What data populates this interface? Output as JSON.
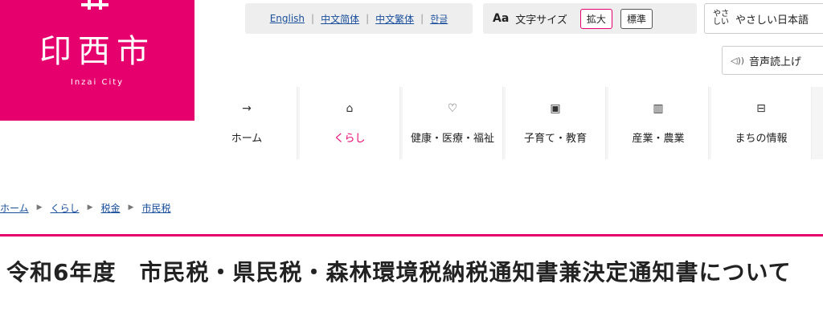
{
  "logo": {
    "name": "印西市",
    "subtitle": "Inzai City",
    "brand_color": "#e5006e"
  },
  "languages": [
    "English",
    "中文简体",
    "中文繁体",
    "한글"
  ],
  "text_size": {
    "icon": "Aa",
    "label": "文字サイズ",
    "enlarge": "拡大",
    "standard": "標準"
  },
  "easy_japanese": {
    "icon": "やさしい-icon",
    "label": "やさしい日本語"
  },
  "read_aloud": {
    "icon": "speaker-icon",
    "label": "音声読上げ"
  },
  "nav": [
    {
      "label": "ホーム",
      "icon": "→"
    },
    {
      "label": "くらし",
      "icon": "⌂"
    },
    {
      "label": "健康・医療・福祉",
      "icon": "♡"
    },
    {
      "label": "子育て・教育",
      "icon": "▣"
    },
    {
      "label": "産業・農業",
      "icon": "▥"
    },
    {
      "label": "まちの情報",
      "icon": "⊟"
    }
  ],
  "breadcrumb": [
    "ホーム",
    "くらし",
    "税金",
    "市民税"
  ],
  "title": "令和6年度　市民税・県民税・森林環境税納税通知書兼決定通知書について"
}
